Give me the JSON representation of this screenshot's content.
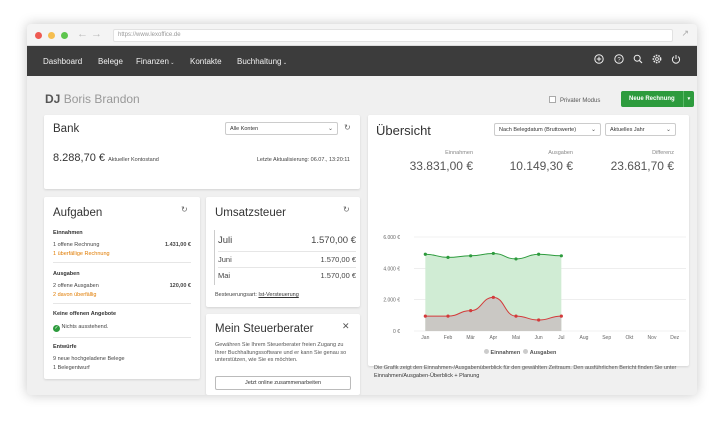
{
  "browser": {
    "url": "https://www.lexoffice.de"
  },
  "nav": {
    "dashboard": "Dashboard",
    "belege": "Belege",
    "finanzen": "Finanzen",
    "kontakte": "Kontakte",
    "buchhaltung": "Buchhaltung"
  },
  "user": {
    "initials": "DJ",
    "name": "Boris Brandon"
  },
  "privater_modus": "Privater Modus",
  "neue_rechnung": "Neue Rechnung",
  "bank": {
    "title": "Bank",
    "account_select": "Alle Konten",
    "balance": "8.288,70 €",
    "balance_label": "Aktueller Kontostand",
    "last_update": "Letzte Aktualisierung: 06.07., 13:20:11"
  },
  "aufgaben": {
    "title": "Aufgaben",
    "einnahmen_title": "Einnahmen",
    "einnahmen_line1": "1  offene Rechnung",
    "einnahmen_amount": "1.431,00 €",
    "einnahmen_line2": "1  überfällige Rechnung",
    "ausgaben_title": "Ausgaben",
    "ausgaben_line1": "2  offene Ausgaben",
    "ausgaben_amount": "120,00 €",
    "ausgaben_line2": "2  davon überfällig",
    "angebote_title": "Keine offenen Angebote",
    "angebote_status": "Nichts ausstehend.",
    "entwuerfe_title": "Entwürfe",
    "entwuerfe_line1": "9  neue hochgeladene Belege",
    "entwuerfe_line2": "1  Belegentwurf"
  },
  "ust": {
    "title": "Umsatzsteuer",
    "rows": [
      {
        "month": "Juli",
        "value": "1.570,00 €"
      },
      {
        "month": "Juni",
        "value": "1.570,00 €"
      },
      {
        "month": "Mai",
        "value": "1.570,00 €"
      }
    ],
    "basis_label": "Besteuerungsart:",
    "basis_value": "Ist-Versteuerung"
  },
  "steuerberater": {
    "title": "Mein Steuerberater",
    "text": "Gewähren Sie Ihrem Steuerberater freien Zugang zu Ihrer Buchhaltungssoftware und er kann Sie genau so unterstützen, wie Sie es möchten.",
    "button": "Jetzt online zusammenarbeiten"
  },
  "uebersicht": {
    "title": "Übersicht",
    "select_basis": "Nach Belegdatum (Bruttowerte)",
    "select_period": "Aktuelles Jahr",
    "einnahmen_label": "Einnahmen",
    "einnahmen_value": "33.831,00 €",
    "ausgaben_label": "Ausgaben",
    "ausgaben_value": "10.149,30 €",
    "differenz_label": "Differenz",
    "differenz_value": "23.681,70 €",
    "legend_einnahmen": "Einnahmen",
    "legend_ausgaben": "Ausgaben",
    "footnote": "Die Grafik zeigt den Einnahmen-/Ausgabenüberblick für den gewählten Zeitraum. Den ausführlichen Bericht finden Sie unter",
    "footnote_link": "Einnahmen/Ausgaben-Überblick + Planung"
  },
  "colors": {
    "green": "#2d9b3d",
    "red": "#d33a3a",
    "navbar": "#3c3c3c"
  },
  "chart_data": {
    "type": "area",
    "categories": [
      "Jan",
      "Feb",
      "Mär",
      "Apr",
      "Mai",
      "Jun",
      "Jul",
      "Aug",
      "Sep",
      "Okt",
      "Nov",
      "Dez"
    ],
    "yticks": [
      "0 €",
      "2.000 €",
      "4.000 €",
      "6.000 €"
    ],
    "ylim": [
      0,
      6000
    ],
    "series": [
      {
        "name": "Einnahmen",
        "values": [
          4900,
          4700,
          4800,
          4950,
          4600,
          4900,
          4800
        ]
      },
      {
        "name": "Ausgaben",
        "values": [
          950,
          950,
          1300,
          2150,
          950,
          700,
          950
        ]
      }
    ],
    "legend": "bottom",
    "grid": true
  }
}
